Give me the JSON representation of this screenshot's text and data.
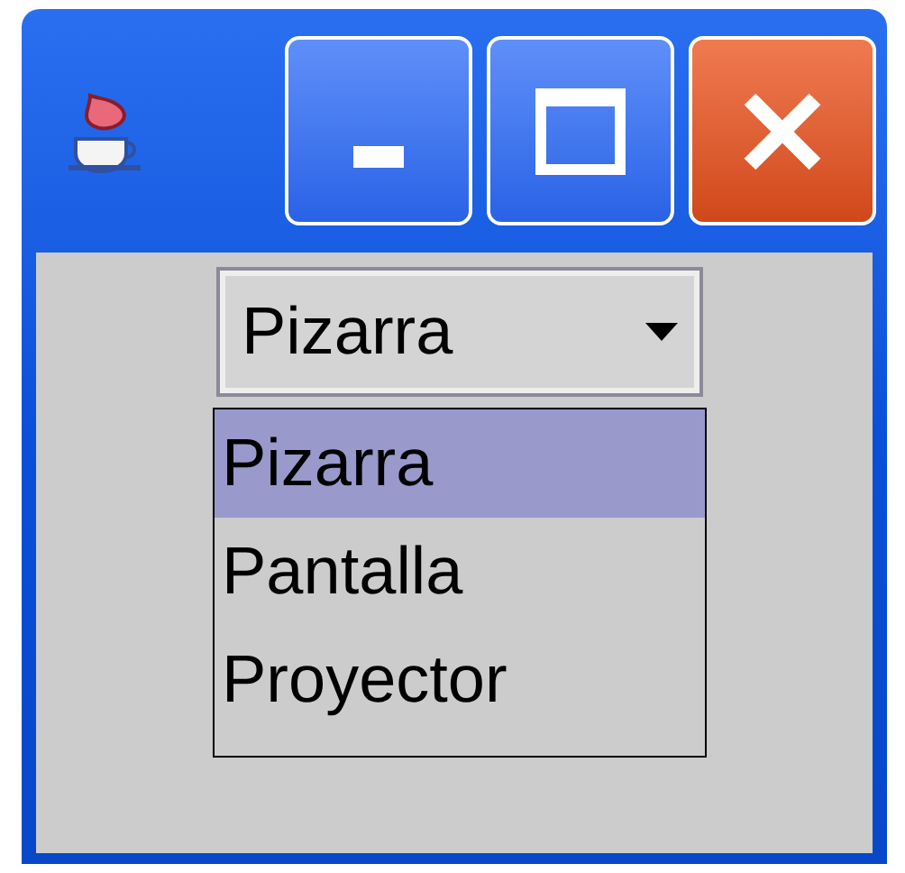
{
  "combo": {
    "value": "Pizarra"
  },
  "options": [
    {
      "label": "Pizarra",
      "selected": true
    },
    {
      "label": "Pantalla",
      "selected": false
    },
    {
      "label": "Proyector",
      "selected": false
    }
  ]
}
